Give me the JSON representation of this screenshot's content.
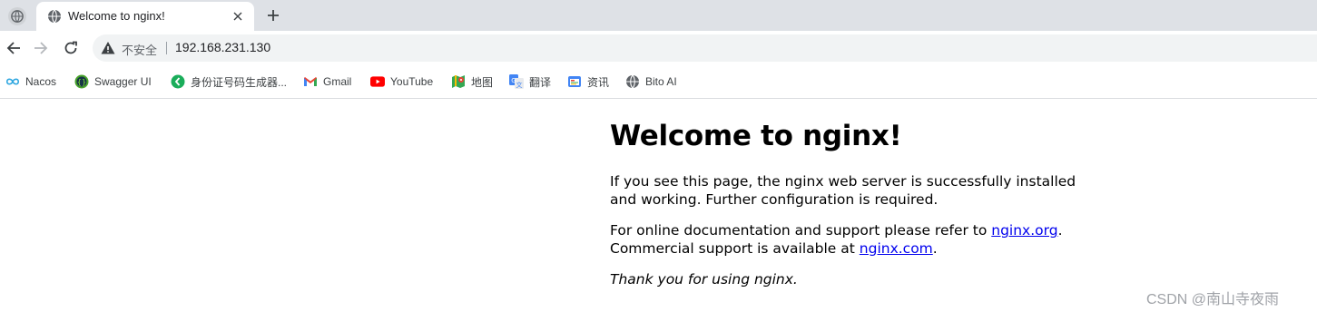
{
  "browser": {
    "tab": {
      "title": "Welcome to nginx!"
    },
    "address_bar": {
      "security_label": "不安全",
      "url": "192.168.231.130"
    },
    "bookmarks": [
      {
        "label": "Nacos",
        "icon": "nacos-infinity-icon"
      },
      {
        "label": "Swagger UI",
        "icon": "swagger-icon"
      },
      {
        "label": "身份证号码生成器...",
        "icon": "id-generator-icon"
      },
      {
        "label": "Gmail",
        "icon": "gmail-icon"
      },
      {
        "label": "YouTube",
        "icon": "youtube-icon"
      },
      {
        "label": "地图",
        "icon": "maps-icon"
      },
      {
        "label": "翻译",
        "icon": "translate-icon"
      },
      {
        "label": "资讯",
        "icon": "news-icon"
      },
      {
        "label": "Bito AI",
        "icon": "globe-icon"
      }
    ]
  },
  "page": {
    "heading": "Welcome to nginx!",
    "para1": "If you see this page, the nginx web server is successfully installed and working. Further configuration is required.",
    "para2_prefix": "For online documentation and support please refer to ",
    "link_org": "nginx.org",
    "para2_mid": ".",
    "para2_line2_prefix": "Commercial support is available at ",
    "link_com": "nginx.com",
    "para2_end": ".",
    "para3": "Thank you for using nginx."
  },
  "watermark": "CSDN @南山寺夜雨",
  "colors": {
    "link": "#0000ee",
    "tabstrip": "#dee1e6",
    "omnibox": "#f1f3f4"
  }
}
